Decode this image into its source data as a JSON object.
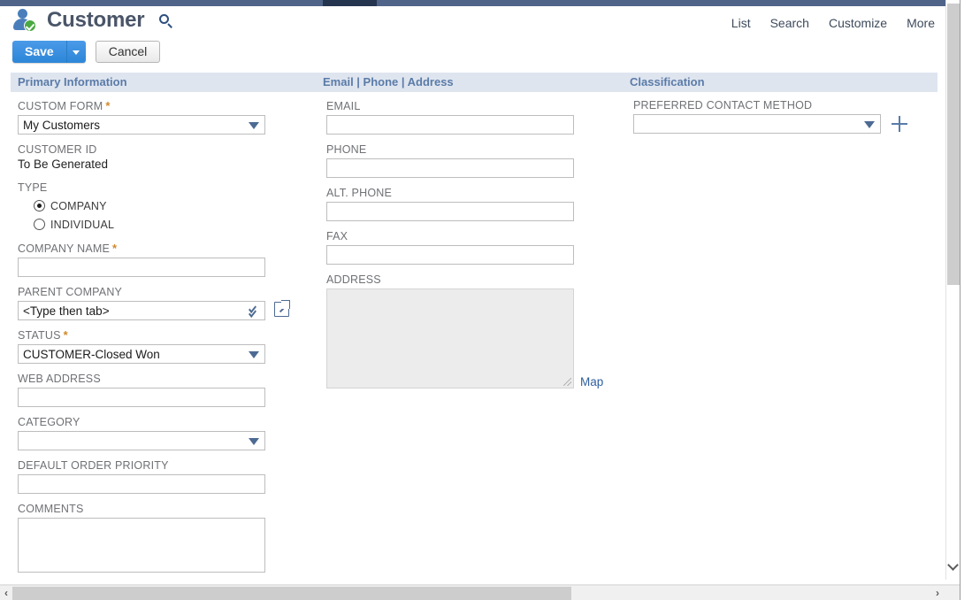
{
  "window": {
    "title": "Customer",
    "record_icon": "customer-person-check-icon",
    "title_search_icon": "search-icon"
  },
  "topnav": {
    "links": [
      {
        "label": "List"
      },
      {
        "label": "Search"
      },
      {
        "label": "Customize"
      },
      {
        "label": "More"
      }
    ]
  },
  "toolbar": {
    "save_label": "Save",
    "save_dropdown_icon": "caret-down-icon",
    "cancel_label": "Cancel"
  },
  "sections": {
    "primary": "Primary Information",
    "contact": "Email | Phone | Address",
    "classification": "Classification"
  },
  "primary_information": {
    "custom_form": {
      "label": "CUSTOM FORM",
      "required": "*",
      "value": "My Customers",
      "dropdown_icon": "caret-down-icon"
    },
    "customer_id": {
      "label": "CUSTOMER ID",
      "value": "To Be Generated"
    },
    "type": {
      "label": "TYPE",
      "options": [
        {
          "label": "COMPANY",
          "selected": true
        },
        {
          "label": "INDIVIDUAL",
          "selected": false
        }
      ]
    },
    "company_name": {
      "label": "COMPANY NAME",
      "required": "*",
      "value": ""
    },
    "parent_company": {
      "label": "PARENT COMPANY",
      "value": "<Type then tab>",
      "dropdown_icon": "double-chevron-down-icon",
      "popup_icon": "open-popup-icon"
    },
    "status": {
      "label": "STATUS",
      "required": "*",
      "value": "CUSTOMER-Closed Won",
      "dropdown_icon": "caret-down-icon"
    },
    "web_address": {
      "label": "WEB ADDRESS",
      "value": ""
    },
    "category": {
      "label": "CATEGORY",
      "value": "",
      "dropdown_icon": "caret-down-icon"
    },
    "default_order_priority": {
      "label": "DEFAULT ORDER PRIORITY",
      "value": ""
    },
    "comments": {
      "label": "COMMENTS",
      "value": ""
    }
  },
  "contact_information": {
    "email": {
      "label": "EMAIL",
      "value": ""
    },
    "phone": {
      "label": "PHONE",
      "value": ""
    },
    "alt_phone": {
      "label": "ALT. PHONE",
      "value": ""
    },
    "fax": {
      "label": "FAX",
      "value": ""
    },
    "address": {
      "label": "ADDRESS",
      "value": "",
      "resize_icon": "resize-grip-icon",
      "map_link": "Map"
    }
  },
  "classification": {
    "preferred_contact_method": {
      "label": "PREFERRED CONTACT METHOD",
      "value": "",
      "dropdown_icon": "caret-down-icon",
      "add_icon": "plus-icon"
    }
  },
  "scrollbars": {
    "horizontal_left_arrow": "‹",
    "horizontal_right_arrow": "›"
  },
  "colors": {
    "accent_blue": "#2d86d8",
    "section_bar": "#dfe5ef",
    "section_text": "#5a7ba8",
    "required_star": "#d08a2a",
    "top_strip": "#4f6488"
  }
}
